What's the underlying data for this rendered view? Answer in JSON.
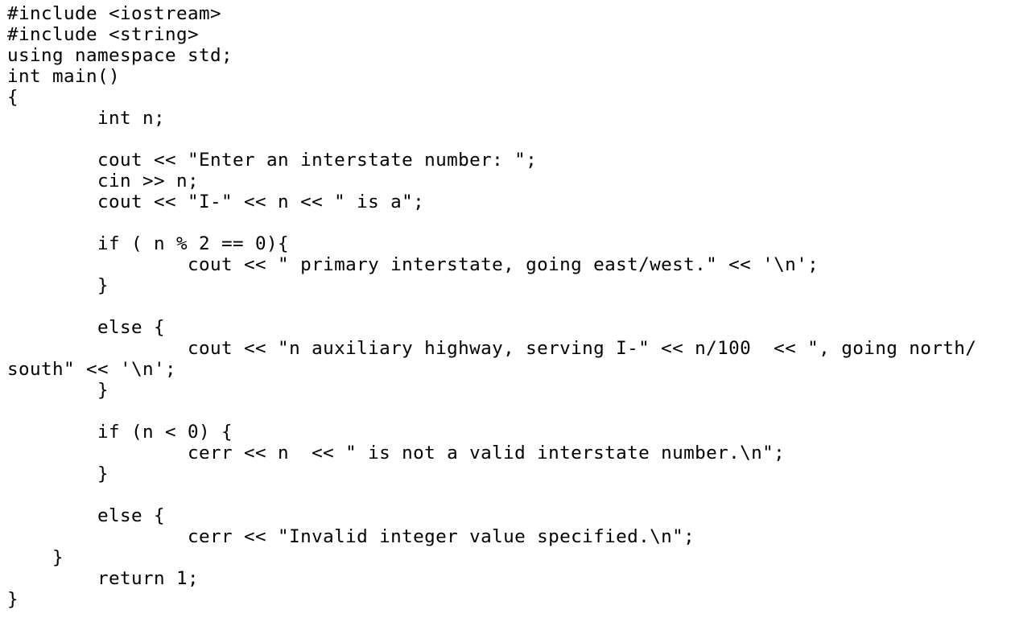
{
  "document": {
    "language": "C++",
    "lines": [
      "#include <iostream>",
      "#include <string>",
      "using namespace std;",
      "int main()",
      "{",
      "        int n;",
      "",
      "        cout << \"Enter an interstate number: \";",
      "        cin >> n;",
      "        cout << \"I-\" << n << \" is a\";",
      "",
      "        if ( n % 2 == 0){",
      "                cout << \" primary interstate, going east/west.\" << '\\n';",
      "        }",
      "",
      "        else {",
      "                cout << \"n auxiliary highway, serving I-\" << n/100  << \", going north/",
      "south\" << '\\n';",
      "        }",
      "",
      "        if (n < 0) {",
      "                cerr << n  << \" is not a valid interstate number.\\n\";",
      "        }",
      "",
      "        else {",
      "                cerr << \"Invalid integer value specified.\\n\";",
      "    }",
      "        return 1;",
      "}"
    ]
  }
}
